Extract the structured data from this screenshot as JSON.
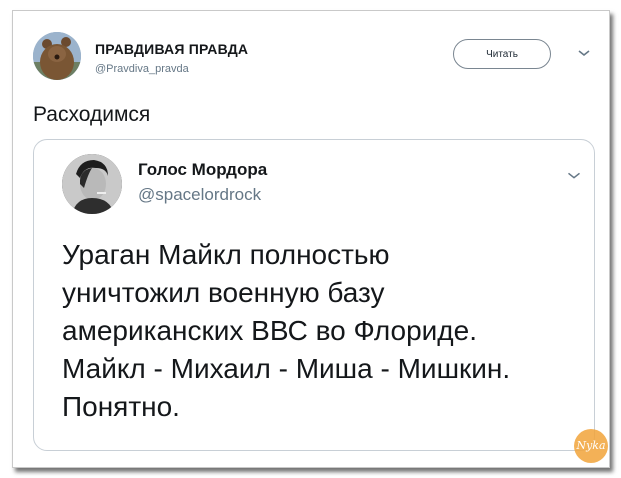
{
  "tweet": {
    "author_name": "ПРАВДИВАЯ ПРАВДА",
    "author_handle": "@Pravdiva_pravda",
    "follow_label": "Читать",
    "text": "Расходимся"
  },
  "quoted_tweet": {
    "author_name": "Голос Мордора",
    "author_handle": "@spacelordrock",
    "text_lines": [
      "Ураган Майкл полностью",
      "уничтожил военную базу",
      "американских ВВС во Флориде.",
      "Майкл - Михаил - Миша - Мишкин.",
      "Понятно."
    ]
  },
  "watermark": {
    "label": "Nyka"
  },
  "icons": {
    "header_chevron": "chevron-down-icon",
    "quote_chevron": "chevron-down-icon"
  },
  "colors": {
    "text_primary": "#14171a",
    "text_secondary": "#657786",
    "card_border": "#c8cfd6",
    "watermark": "#f2a43a"
  }
}
